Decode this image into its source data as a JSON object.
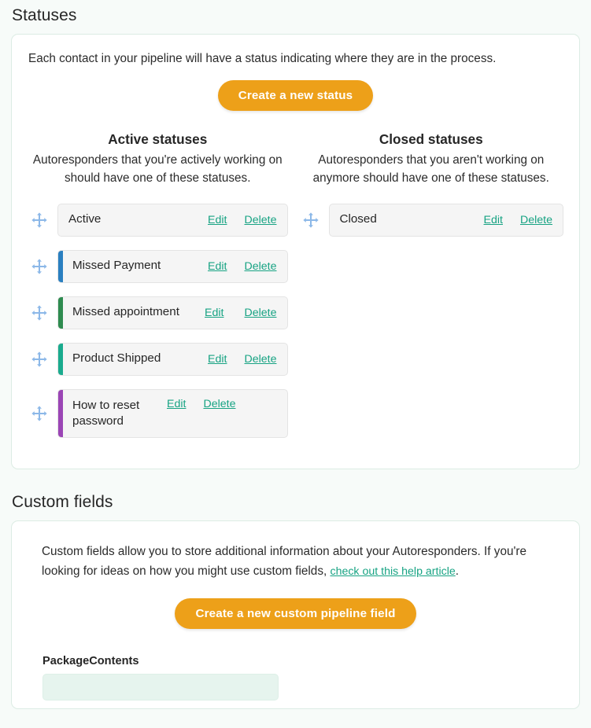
{
  "statuses_section": {
    "title": "Statuses",
    "intro": "Each contact in your pipeline will have a status indicating where they are in the process.",
    "create_button": "Create a new status",
    "active_column": {
      "title": "Active statuses",
      "description": "Autoresponders that you're actively working on should have one of these statuses.",
      "items": [
        {
          "name": "Active",
          "color": "",
          "edit": "Edit",
          "delete": "Delete"
        },
        {
          "name": "Missed Payment",
          "color": "#2a7fc0",
          "edit": "Edit",
          "delete": "Delete"
        },
        {
          "name": "Missed appointment",
          "color": "#2e8b4f",
          "edit": "Edit",
          "delete": "Delete"
        },
        {
          "name": "Product Shipped",
          "color": "#1aab8e",
          "edit": "Edit",
          "delete": "Delete"
        },
        {
          "name": "How to reset password",
          "color": "#9b45b5",
          "edit": "Edit",
          "delete": "Delete"
        }
      ]
    },
    "closed_column": {
      "title": "Closed statuses",
      "description": "Autoresponders that you aren't working on anymore should have one of these statuses.",
      "items": [
        {
          "name": "Closed",
          "color": "",
          "edit": "Edit",
          "delete": "Delete"
        }
      ]
    }
  },
  "custom_fields_section": {
    "title": "Custom fields",
    "description_part1": "Custom fields allow you to store additional information about your Autoresponders. If you're looking for ideas on how you might use custom fields, ",
    "help_link": "check out this help article",
    "description_part2": ".",
    "create_button": "Create a new custom pipeline field",
    "fields": [
      {
        "label": "PackageContents",
        "value": "",
        "placeholder": ""
      }
    ]
  },
  "theme": {
    "accent_orange": "#eda019",
    "link_green": "#17a383",
    "page_background": "#f7fbf9",
    "card_border": "#dcece4",
    "pill_background": "#f5f5f5",
    "input_background": "#e6f4ee",
    "drag_handle_color": "#8cb8e8"
  },
  "icons": {
    "drag": "move-arrows-icon"
  }
}
